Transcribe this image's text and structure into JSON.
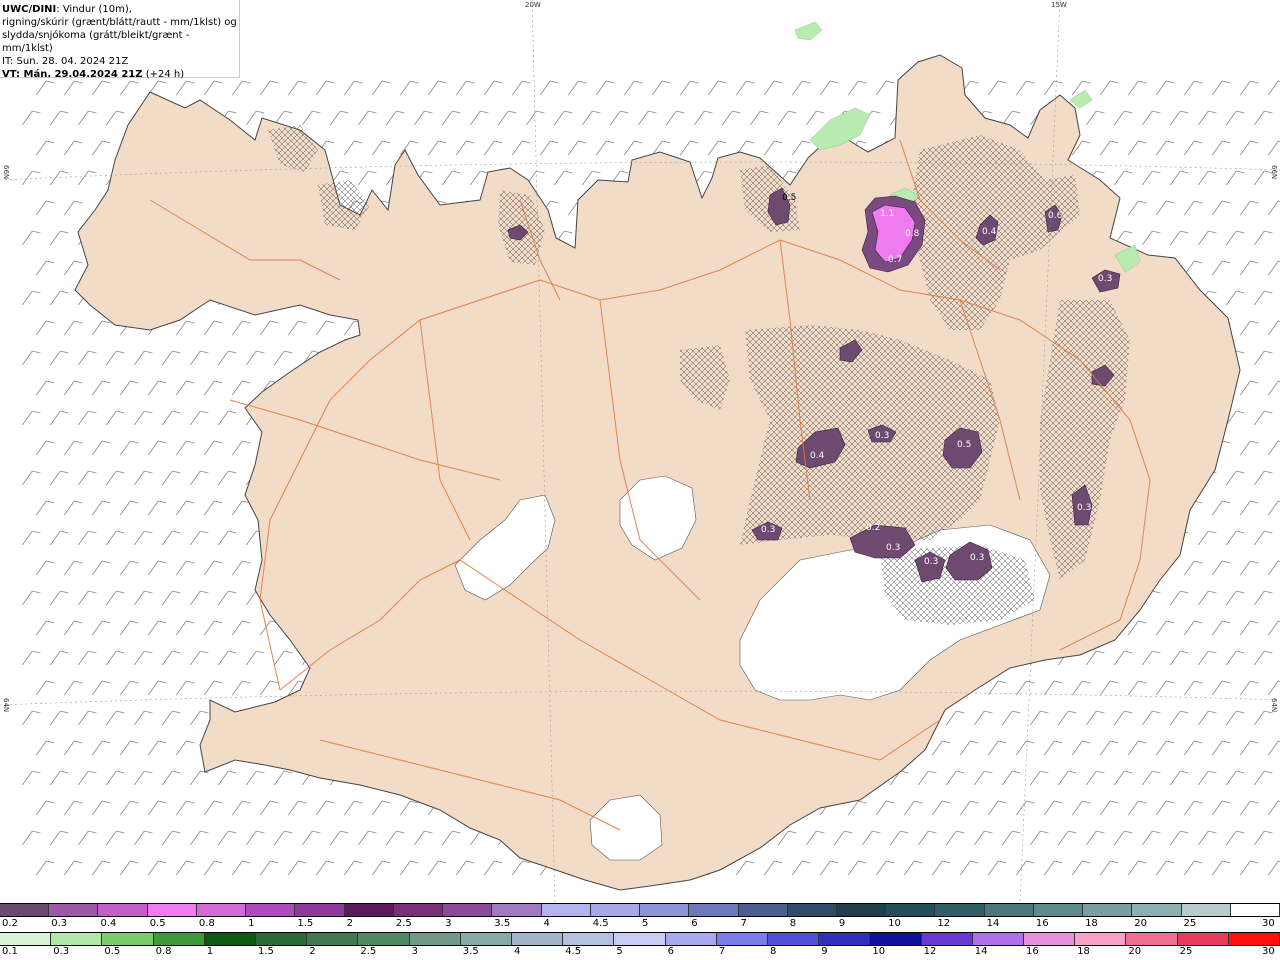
{
  "header": {
    "model": "UWC/DINI",
    "desc1": ": Vindur (10m),",
    "desc2": "rigning/skúrir (grænt/blátt/rautt - mm/1klst) og",
    "desc3": "slydda/snjókoma (grátt/bleikt/grænt - mm/1klst)",
    "it": "IT: Sun. 28. 04. 2024 21Z",
    "vt": "VT: Mán. 29.04.2024 21Z",
    "vt_suffix": " (+24 h)"
  },
  "grid_labels": {
    "lon_20w": "20W",
    "lon_15w": "15W",
    "lat_66n_left": "66N",
    "lat_66n_right": "66N",
    "lat_64n_left": "64N",
    "lat_64n_right": "64N"
  },
  "precip_labels": [
    {
      "text": "0.5"
    },
    {
      "text": "1.1"
    },
    {
      "text": "0.8"
    },
    {
      "text": "0.7"
    },
    {
      "text": "0.4"
    },
    {
      "text": "0.6"
    },
    {
      "text": "0.3"
    },
    {
      "text": "0.4"
    },
    {
      "text": "0.3"
    },
    {
      "text": "0.5"
    },
    {
      "text": "0.3"
    },
    {
      "text": "0.3"
    },
    {
      "text": "0.2"
    },
    {
      "text": "0.3"
    },
    {
      "text": "0.3"
    },
    {
      "text": "0.3"
    }
  ],
  "snow_scale": {
    "labels": [
      "0.2",
      "0.3",
      "0.4",
      "0.5",
      "0.8",
      "1",
      "1.5",
      "2",
      "2.5",
      "3",
      "3.5",
      "4",
      "4.5",
      "5",
      "6",
      "7",
      "8",
      "9",
      "10",
      "12",
      "14",
      "16",
      "18",
      "20",
      "25",
      "30"
    ],
    "colors": [
      "#6a4a6e",
      "#9b59a8",
      "#c45ec9",
      "#ee7bf0",
      "#d46ad8",
      "#b04bbd",
      "#8e3a9c",
      "#5c1a5c",
      "#7a2f7a",
      "#8d4a9a",
      "#a07ac0",
      "#b6b2f0",
      "#a8a8e8",
      "#8d94d8",
      "#6b7ab8",
      "#4a5f8f",
      "#2f4a6b",
      "#1f3f4a",
      "#234f5a",
      "#2f6068",
      "#4a7878",
      "#5f8a8a",
      "#78a0a0",
      "#8ab0b0",
      "#b8cccc",
      "#ffffff"
    ]
  },
  "rain_scale": {
    "labels": [
      "0.1",
      "0.3",
      "0.5",
      "0.8",
      "1",
      "1.5",
      "2",
      "2.5",
      "3",
      "3.5",
      "4",
      "4.5",
      "5",
      "6",
      "7",
      "8",
      "9",
      "10",
      "12",
      "14",
      "16",
      "18",
      "20",
      "25",
      "30"
    ],
    "colors": [
      "#d8f5d8",
      "#b0e8a8",
      "#7ccc6a",
      "#3f9a3a",
      "#0e5a12",
      "#2d6a3a",
      "#3e7a4e",
      "#4f8a64",
      "#6f9a8a",
      "#8aaaa8",
      "#a0b4c8",
      "#b4c0e0",
      "#c8ccf4",
      "#a8a8f0",
      "#7c7ce8",
      "#5050d8",
      "#3030c0",
      "#1010a0",
      "#6a3ad0",
      "#b070e8",
      "#e890e0",
      "#f8a0c8",
      "#f07090",
      "#e83a5a",
      "#ff1010"
    ]
  }
}
